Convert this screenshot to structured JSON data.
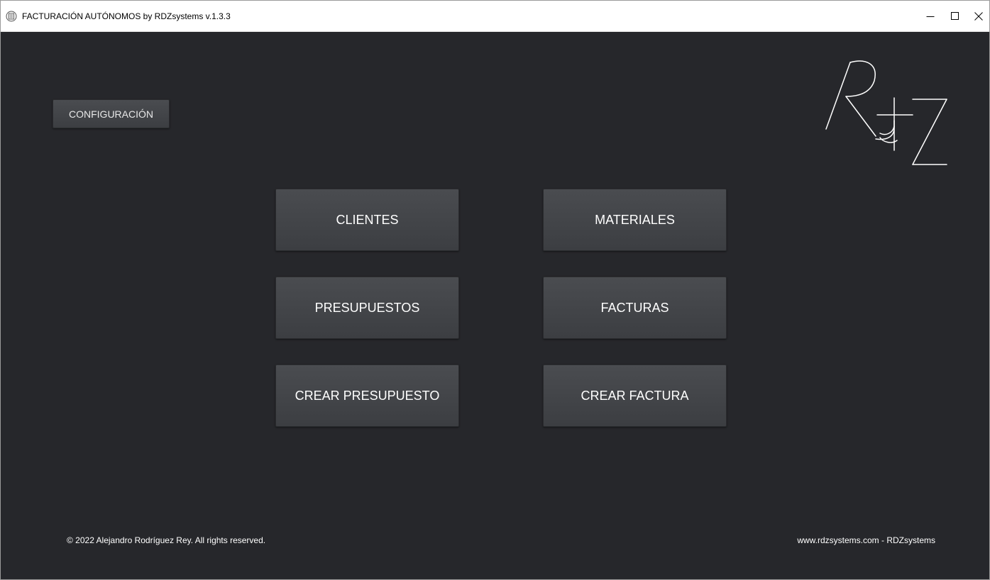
{
  "window": {
    "title": "FACTURACIÓN AUTÓNOMOS by RDZsystems v.1.3.3",
    "controls": {
      "minimize_glyph": "—",
      "maximize_glyph": "☐",
      "close_glyph": "✕"
    }
  },
  "toolbar": {
    "config_label": "CONFIGURACIÓN"
  },
  "menu": {
    "clientes_label": "CLIENTES",
    "materiales_label": "MATERIALES",
    "presupuestos_label": "PRESUPUESTOS",
    "facturas_label": "FACTURAS",
    "crear_presupuesto_label": "CREAR PRESUPUESTO",
    "crear_factura_label": "CREAR FACTURA"
  },
  "footer": {
    "copyright": "© 2022 Alejandro Rodríguez Rey. All rights reserved.",
    "website": "www.rdzsystems.com - RDZsystems"
  },
  "brand": {
    "logo_text": "RDZ"
  },
  "colors": {
    "background": "#26272b",
    "button": "#44464a",
    "text": "#ffffff",
    "logo_stroke": "#ffffff"
  }
}
